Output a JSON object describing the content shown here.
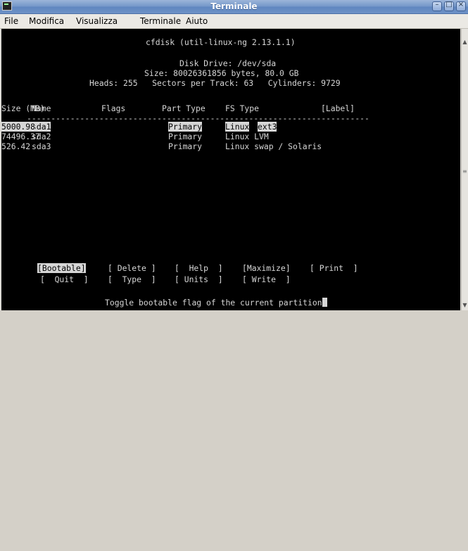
{
  "window": {
    "title": "Terminale",
    "buttons": {
      "minimize": "–",
      "maximize": "□",
      "close": "×"
    }
  },
  "menu": [
    "File",
    "Modifica",
    "Visualizza",
    "Terminale",
    "Aiuto"
  ],
  "terminal": {
    "header": "cfdisk (util-linux-ng 2.13.1.1)",
    "disk_drive": "Disk Drive: /dev/sda",
    "size_line": "Size: 80026361856 bytes, 80.0 GB",
    "geometry_line": "Heads: 255   Sectors per Track: 63   Cylinders: 9729",
    "columns": {
      "name": "Name",
      "flags": "Flags",
      "part_type": "Part Type",
      "fs_type": "FS Type",
      "label": "[Label]",
      "size": "Size (MB)"
    },
    "separator": "-----------------------------------------------------------------------",
    "partitions": [
      {
        "name": "sda1",
        "flags": "",
        "part_type": "Primary",
        "fs_a": "Linux",
        "fs_b": "ext3",
        "size": "5000.98"
      },
      {
        "name": "sda2",
        "flags": "",
        "part_type": "Primary",
        "fs_a": "Linux LVM",
        "fs_b": "",
        "size": "74496.37"
      },
      {
        "name": "sda3",
        "flags": "",
        "part_type": "Primary",
        "fs_a": "Linux swap / Solaris",
        "fs_b": "",
        "size": "526.42"
      }
    ],
    "menu_row1": {
      "bootable": "[Bootable]",
      "delete": "[ Delete ]",
      "help": "[  Help  ]",
      "maximize": "[Maximize]",
      "print": "[ Print  ]"
    },
    "menu_row2": {
      "quit": "[  Quit  ]",
      "type": "[  Type  ]",
      "units": "[ Units  ]",
      "write": "[ Write  ]"
    },
    "status": "Toggle bootable flag of the current partition"
  },
  "colors": {
    "terminal_bg": "#000000",
    "terminal_fg": "#d6d6d6",
    "titlebar": "#6e92c7"
  },
  "icons": [
    "terminal-app-icon",
    "minimize-icon",
    "maximize-icon",
    "close-icon",
    "scroll-up-icon",
    "scroll-down-icon"
  ]
}
